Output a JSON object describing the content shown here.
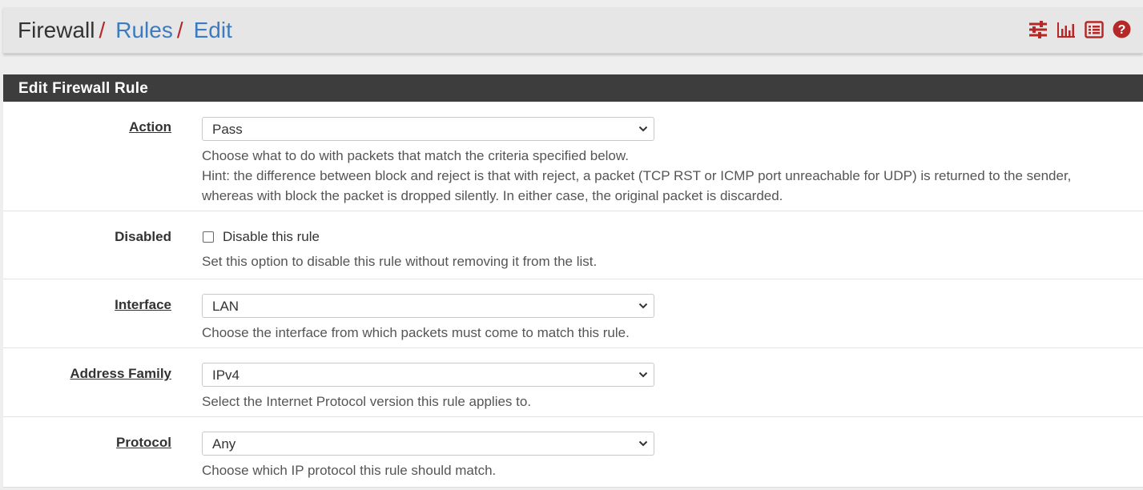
{
  "breadcrumb": {
    "root": "Firewall",
    "separator": "/",
    "rules": "Rules",
    "edit": "Edit"
  },
  "header_icons": [
    "sliders-icon",
    "bar-chart-icon",
    "list-icon",
    "help-icon"
  ],
  "colors": {
    "accent": "#b52828",
    "link": "#3c7bbf",
    "panel_heading": "#3d3d3d"
  },
  "panel": {
    "title": "Edit Firewall Rule",
    "rows": {
      "action": {
        "label": "Action",
        "value": "Pass",
        "help": [
          "Choose what to do with packets that match the criteria specified below.",
          "Hint: the difference between block and reject is that with reject, a packet (TCP RST or ICMP port unreachable for UDP) is returned to the sender,",
          "whereas with block the packet is dropped silently. In either case, the original packet is discarded."
        ]
      },
      "disabled": {
        "label": "Disabled",
        "checkbox_label": "Disable this rule",
        "checked": false,
        "help": "Set this option to disable this rule without removing it from the list."
      },
      "interface": {
        "label": "Interface",
        "value": "LAN",
        "help": "Choose the interface from which packets must come to match this rule."
      },
      "address_family": {
        "label": "Address Family",
        "value": "IPv4",
        "help": "Select the Internet Protocol version this rule applies to."
      },
      "protocol": {
        "label": "Protocol",
        "value": "Any",
        "help": "Choose which IP protocol this rule should match."
      }
    }
  }
}
